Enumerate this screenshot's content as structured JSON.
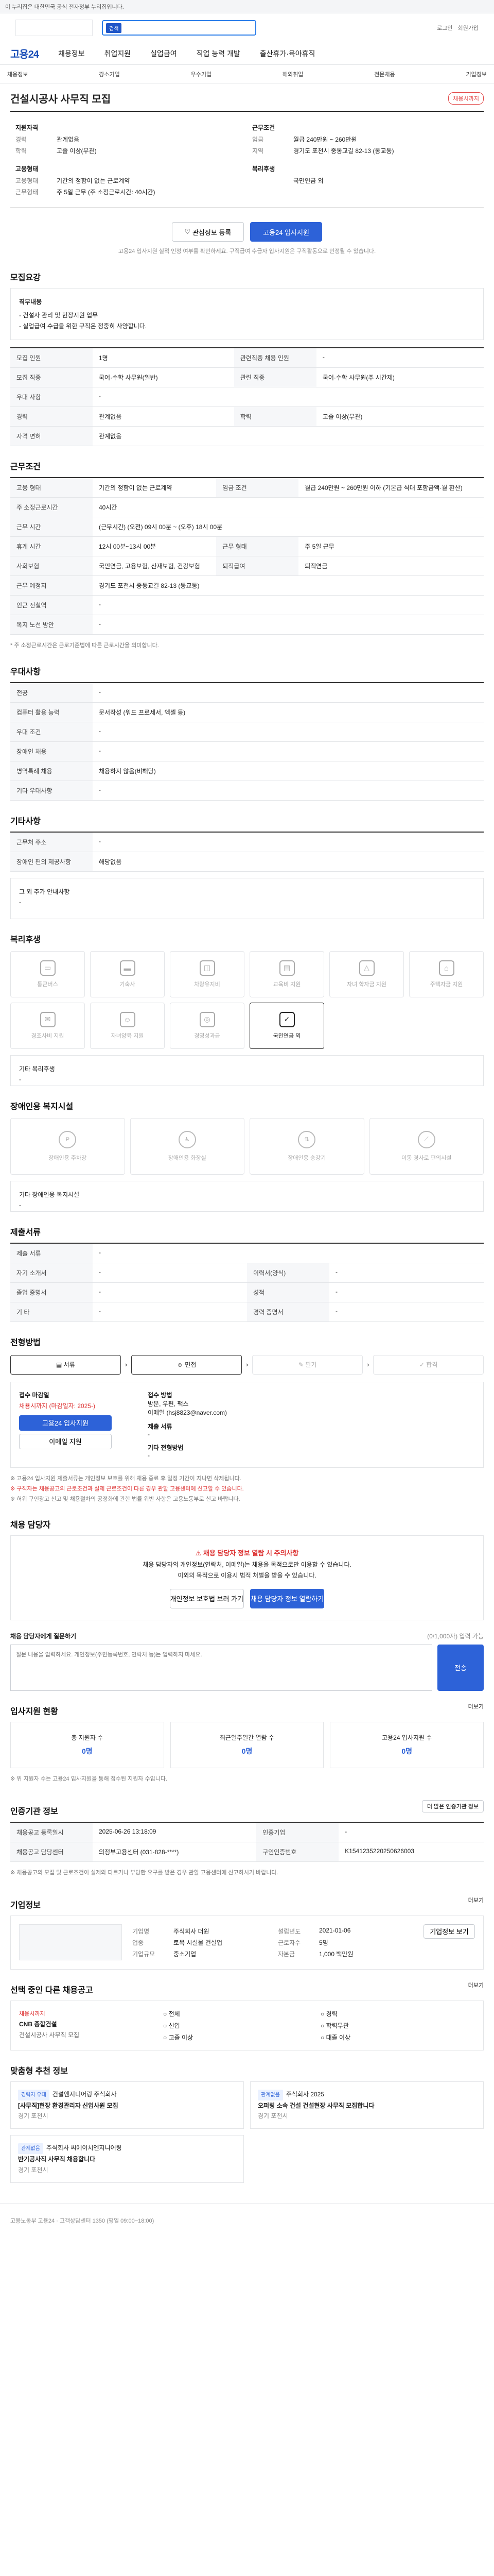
{
  "topbar": {
    "text": "이 누리집은 대한민국 공식 전자정부 누리집입니다."
  },
  "search": {
    "tag": "검색"
  },
  "util": {
    "login": "로그인",
    "join": "회원가입"
  },
  "gnb": {
    "logo": "고용24",
    "items": [
      "채용정보",
      "취업지원",
      "실업급여",
      "직업 능력 개발",
      "출산휴가·육아휴직"
    ]
  },
  "subnav": {
    "items": [
      "채용정보",
      "강소기업",
      "우수기업",
      "해외취업",
      "전문채용",
      "기업정보"
    ]
  },
  "job": {
    "title": "건설시공사 사무직 모집",
    "badge": "채용시까지",
    "left_heading": "지원자격",
    "left_rows": [
      {
        "k": "경력",
        "v": "관계없음"
      },
      {
        "k": "학력",
        "v": "고졸 이상(무관)"
      }
    ],
    "left_heading2": "고용형태",
    "left_rows2": [
      {
        "k": "고용형태",
        "v": "기간의 정함이 없는 근로계약"
      },
      {
        "k": "근무형태",
        "v": "주 5일 근무 (주 소정근로시간: 40시간)"
      }
    ],
    "right_heading": "근무조건",
    "right_rows": [
      {
        "k": "임금",
        "v": "월급 240만원 ~ 260만원"
      },
      {
        "k": "지역",
        "v": "경기도 포천시 중동교길 82-13 (동교동)"
      }
    ],
    "right_heading2": "복리후생",
    "right_rows2": [
      {
        "k": "",
        "v": "국민연금 외"
      }
    ]
  },
  "buttons": {
    "interest": "관심정보 등록",
    "apply": "고용24 입사지원"
  },
  "notice": "고용24 입사지원 실적 인정 여부를 확인하세요. 구직급여 수급자 입사지원은 구직활동으로 인정될 수 있습니다.",
  "recruit": {
    "title": "모집요강",
    "duty_label": "직무내용",
    "duty_lines": [
      "- 건설사 관리 및 현장지원 업무",
      "- 실업급여 수급을 위한 구직은 정중히 사양합니다."
    ],
    "rows": [
      {
        "k": "모집 인원",
        "v": "1명",
        "k2": "관련직종 채용 인원",
        "v2": "-"
      },
      {
        "k": "모집 직종",
        "v": "국어·수학 사무원(일반)",
        "k2": "관련 직종",
        "v2": "국어·수학 사무원(주 시간제)"
      },
      {
        "k": "우대 사항",
        "v": "-",
        "k2": "",
        "v2": ""
      },
      {
        "k": "경력",
        "v": "관계없음",
        "k2": "학력",
        "v2": "고졸 이상(무관)"
      },
      {
        "k": "자격 면허",
        "v": "관계없음",
        "k2": "",
        "v2": ""
      }
    ]
  },
  "cond": {
    "title": "근무조건",
    "rows": [
      {
        "k": "고용 형태",
        "v": "기간의 정함이 없는 근로계약",
        "k2": "임금 조건",
        "v2": "월급 240만원 ~ 260만원 이하 (기본급 식대 포함금액·월 환산)"
      },
      {
        "k": "주 소정근로시간",
        "v": "40시간",
        "k2": "",
        "v2": ""
      },
      {
        "k": "근무 시간",
        "v": "(근무시간) (오전) 09시 00분 ~ (오후) 18시 00분",
        "k2": "",
        "v2": ""
      },
      {
        "k": "휴게 시간",
        "v": "12시 00분~13시 00분",
        "k2": "근무 형태",
        "v2": "주 5일 근무"
      },
      {
        "k": "사회보험",
        "v": "국민연금, 고용보험, 산재보험, 건강보험",
        "k2": "퇴직급여",
        "v2": "퇴직연금"
      },
      {
        "k": "근무 예정지",
        "v": "경기도 포천시 중동교길 82-13 (동교동)",
        "k2": "",
        "v2": ""
      },
      {
        "k": "인근 전철역",
        "v": "-",
        "k2": "",
        "v2": ""
      },
      {
        "k": "복지 노선 방안",
        "v": "-",
        "k2": "",
        "v2": ""
      }
    ],
    "footnote": "* 주 소정근로시간은 근로기준법에 따른 근로시간을 의미합니다."
  },
  "pref": {
    "title": "우대사항",
    "rows": [
      {
        "k": "전공",
        "v": "-"
      },
      {
        "k": "컴퓨터 활용 능력",
        "v": "문서작성 (워드 프로세서, 엑셀 등)"
      },
      {
        "k": "우대 조건",
        "v": "-"
      },
      {
        "k": "장애인 채용",
        "v": "-"
      },
      {
        "k": "병역특례 채용",
        "v": "채용하지 않음(비해당)"
      },
      {
        "k": "기타 우대사항",
        "v": "-"
      }
    ]
  },
  "etc": {
    "title": "기타사항",
    "rows": [
      {
        "k": "근무처 주소",
        "v": "-"
      },
      {
        "k": "장애인 편의 제공사항",
        "v": "해당없음"
      }
    ],
    "more_label": "그 외 추가 안내사항",
    "more_value": "-"
  },
  "welfare": {
    "title": "복리후생",
    "items": [
      "통근버스",
      "기숙사",
      "차량유지비",
      "교육비 지원",
      "자녀 학자금 지원",
      "주택자금 지원",
      "경조사비 지원",
      "자녀양육 지원",
      "경영성과급",
      "국민연금 외"
    ],
    "extra_label": "기타 복리후생",
    "extra_value": "-"
  },
  "accessibility": {
    "title": "장애인용 복지시설",
    "items": [
      "장애인용 주차장",
      "장애인용 화장실",
      "장애인용 승강기",
      "이동 경사로 편의시설"
    ],
    "extra_label": "기타 장애인용 복지시설",
    "extra_value": "-"
  },
  "docs": {
    "title": "제출서류",
    "rows": [
      {
        "k": "제출 서류",
        "v": "-",
        "k2": "",
        "v2": ""
      },
      {
        "k": "자기 소개서",
        "v": "-",
        "k2": "이력서(양식)",
        "v2": "-"
      },
      {
        "k": "졸업 증명서",
        "v": "-",
        "k2": "성적",
        "v2": "-"
      },
      {
        "k": "기 타",
        "v": "-",
        "k2": "경력 증명서",
        "v2": "-"
      }
    ]
  },
  "process": {
    "title": "전형방법",
    "steps": [
      "서류",
      "면접",
      "필기",
      "합격"
    ],
    "apply_label": "접수 마감일",
    "apply_value": "채용시까지 (마감일자: 2025-)",
    "apply_method_label": "접수 방법",
    "apply_methods": [
      "방문, 우편, 팩스",
      "이메일 (hsj8823@naver.com)"
    ],
    "apply_btn": "고용24 입사지원",
    "apply_btn2": "이메일 지원",
    "form_label": "제출 서류",
    "form_value": "-",
    "extra_label": "기타 전형방법",
    "extra_value": "-"
  },
  "notes": [
    "※ 고용24 입사지원 제출서류는 개인정보 보호를 위해 채용 종료 후 일정 기간이 지나면 삭제됩니다.",
    "※ 구직자는 채용공고의 근로조건과 실제 근로조건이 다른 경우 관할 고용센터에 신고할 수 있습니다.",
    "※ 허위 구인광고 신고 및 채용절차의 공정화에 관한 법률 위반 사항은 고용노동부로 신고 바랍니다."
  ],
  "contact": {
    "title": "채용 담당자",
    "warn": "채용 담당자 정보 열람 시 주의사항",
    "desc1": "채용 담당자의 개인정보(연락처, 이메일)는 채용을 목적으로만 이용할 수 있습니다.",
    "desc2": "이외의 목적으로 이용시 법적 처벌을 받을 수 있습니다.",
    "btn1": "개인정보 보호법 보러 가기",
    "btn2": "채용 담당자 정보 열람하기",
    "inquiry_label": "채용 담당자에게 질문하기",
    "inquiry_note": "(0/1,000자) 입력 가능",
    "inquiry_placeholder": "질문 내용을 입력하세요. 개인정보(주민등록번호, 연락처 등)는 입력하지 마세요.",
    "inquiry_btn": "전송"
  },
  "status": {
    "title": "입사지원 현황",
    "link": "더보기",
    "stats": [
      {
        "label": "총 지원자 수",
        "value": "0명"
      },
      {
        "label": "최근일주일간 열람 수",
        "value": "0명"
      },
      {
        "label": "고용24 입사지원 수",
        "value": "0명"
      }
    ],
    "footnote": "※ 위 지원자 수는 고용24 입사지원을 통해 접수된 지원자 수입니다."
  },
  "agency": {
    "title": "인증기관 정보",
    "link": "더 많은 인증기관 정보",
    "rows": [
      {
        "k": "채용공고 등록일시",
        "v": "2025-06-26 13:18:09",
        "k2": "인증기업",
        "v2": "-"
      },
      {
        "k": "채용공고 담당센터",
        "v": "의정부고용센터 (031-828-****)",
        "k2": "구인인증번호",
        "v2": "K1541235220250626003"
      }
    ],
    "notes": "※ 채용공고의 모집 및 근로조건이 실제와 다르거나 부당한 요구를 받은 경우 관할 고용센터에 신고하시기 바랍니다."
  },
  "company": {
    "title": "기업정보",
    "link": "더보기",
    "name_label": "기업명",
    "name": "주식회사 더원",
    "industry_label": "업종",
    "industry": "토목 시설물 건설업",
    "size_label": "기업규모",
    "size": "중소기업",
    "founded_label": "설립년도",
    "founded": "2021-01-06",
    "employees_label": "근로자수",
    "employees": "5명",
    "capital_label": "자본금",
    "capital": "1,000 백만원",
    "btn": "기업정보 보기"
  },
  "similar": {
    "title": "선택 중인 다른 채용공고",
    "link": "더보기",
    "company_tag": "채용시까지",
    "company": "CNB 종합건설",
    "position": "건설시공사 사무직 모집",
    "filters": [
      "전체",
      "경력",
      "신입",
      "학력무관",
      "고졸 이상",
      "대졸 이상"
    ]
  },
  "recommend": {
    "title": "맞춤형 추천 정보",
    "cards": [
      {
        "tag": "경력자 우대",
        "org": "건설엔지니어링 주식회사",
        "title": "[사무직]현장 환경관리자 신입사원 모집",
        "meta": "경기 포천시"
      },
      {
        "tag": "관계없음",
        "org": "주식회사 2025",
        "title": "오퍼링 소속 건설 건설현장 사무직 모집합니다",
        "meta": "경기 포천시"
      },
      {
        "tag": "관계없음",
        "org": "주식회사 씨에이치엔지니어링",
        "title": "반기공사직 사무직 채용합니다",
        "meta": "경기 포천시"
      }
    ]
  },
  "footer": {
    "text": "고용노동부 고용24 · 고객상담센터 1350 (평일 09:00~18:00)"
  }
}
